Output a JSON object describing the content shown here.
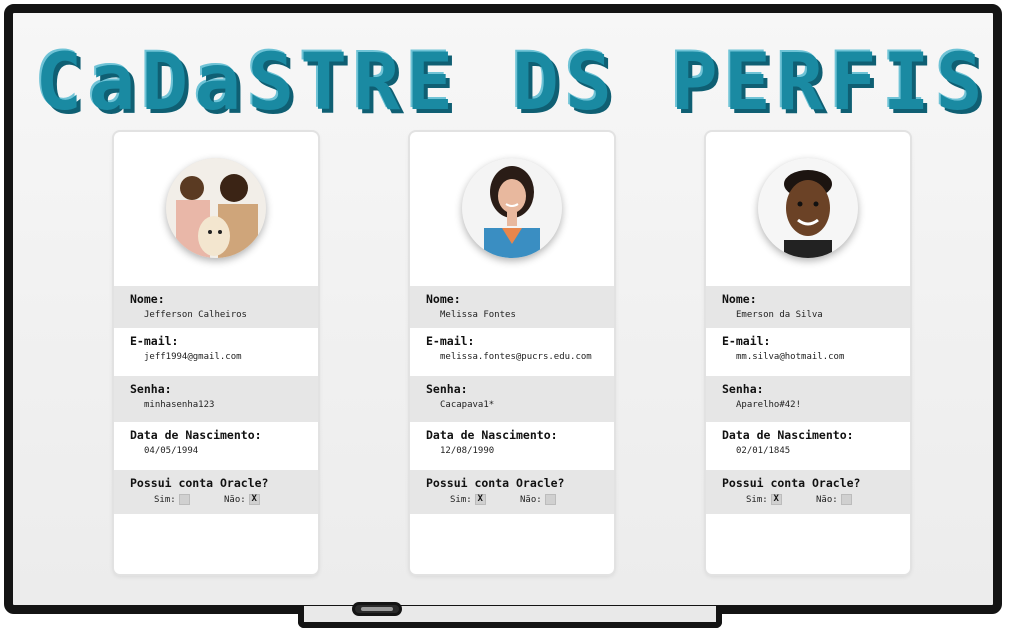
{
  "title": "CaDaSTRE DS PERFIS",
  "profiles": [
    {
      "name_label": "Nome:",
      "name": "Jefferson Calheiros",
      "email_label": "E-mail:",
      "email": "jeff1994@gmail.com",
      "password_label": "Senha:",
      "password": "minhasenha123",
      "birth_label": "Data de Nascimento:",
      "birth": "04/05/1994",
      "oracle_label": "Possui conta Oracle?",
      "sim_label": "Sim:",
      "nao_label": "Não:",
      "sim_mark": "",
      "nao_mark": "X"
    },
    {
      "name_label": "Nome:",
      "name": "Melissa Fontes",
      "email_label": "E-mail:",
      "email": "melissa.fontes@pucrs.edu.com",
      "password_label": "Senha:",
      "password": "Cacapava1*",
      "birth_label": "Data de Nascimento:",
      "birth": "12/08/1990",
      "oracle_label": "Possui conta Oracle?",
      "sim_label": "Sim:",
      "nao_label": "Não:",
      "sim_mark": "X",
      "nao_mark": ""
    },
    {
      "name_label": "Nome:",
      "name": "Emerson da Silva",
      "email_label": "E-mail:",
      "email": "mm.silva@hotmail.com",
      "password_label": "Senha:",
      "password": "Aparelho#42!",
      "birth_label": "Data de Nascimento:",
      "birth": "02/01/1845",
      "oracle_label": "Possui conta Oracle?",
      "sim_label": "Sim:",
      "nao_label": "Não:",
      "sim_mark": "X",
      "nao_mark": ""
    }
  ],
  "colors": {
    "title": "#1a8aa2",
    "row_shade": "#e6e6e6",
    "frame": "#141414"
  }
}
